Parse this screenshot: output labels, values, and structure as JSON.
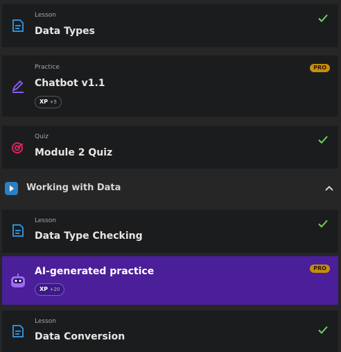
{
  "items": [
    {
      "kind": "Lesson",
      "title": "Data Types"
    },
    {
      "kind": "Practice",
      "title": "Chatbot v1.1",
      "pro": "PRO",
      "xp_label": "XP",
      "xp_value": "+5"
    },
    {
      "kind": "Quiz",
      "title": "Module 2 Quiz"
    }
  ],
  "section": {
    "title": "Working with Data"
  },
  "section_items": [
    {
      "kind": "Lesson",
      "title": "Data Type Checking"
    },
    {
      "title": "AI-generated practice",
      "pro": "PRO",
      "xp_label": "XP",
      "xp_value": "+20"
    },
    {
      "kind": "Lesson",
      "title": "Data Conversion"
    }
  ],
  "icons": {
    "lesson": "document-icon",
    "practice": "pencil-icon",
    "quiz": "target-icon",
    "section": "play-icon",
    "ai": "robot-icon",
    "done": "checkmark-icon",
    "collapse": "chevron-up-icon"
  },
  "colors": {
    "lesson_icon": "#2f8fd6",
    "practice_icon": "#8a5cf0",
    "quiz_icon": "#e0245e",
    "check": "#6fd45b",
    "pro_badge": "#c98d0d",
    "active_card": "#4b1f9a"
  }
}
